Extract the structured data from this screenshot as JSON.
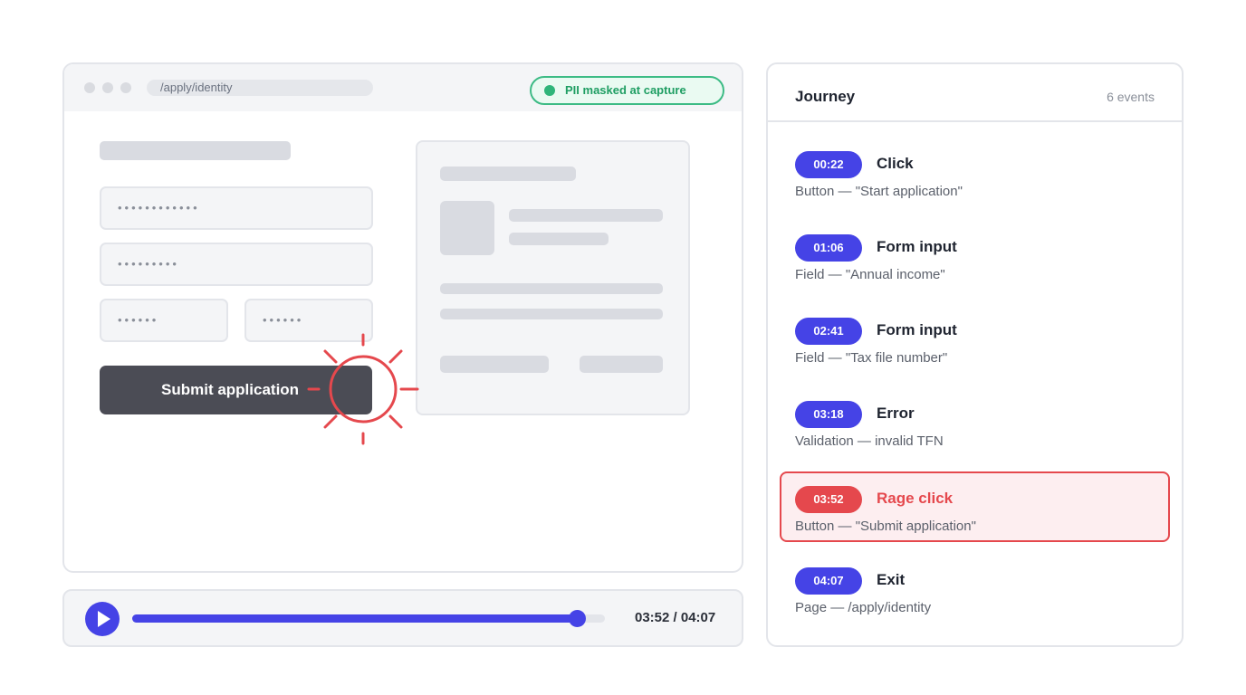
{
  "browser": {
    "url": "/apply/identity",
    "pii_badge": "PII masked at capture",
    "fields": [
      "••••••••••••",
      "•••••••••",
      "••••••",
      "••••••"
    ],
    "submit_label": "Submit application"
  },
  "player": {
    "time": "03:52 / 04:07",
    "progress": 0.94
  },
  "journey": {
    "title": "Journey",
    "count": "6 events",
    "events": [
      {
        "time": "00:22",
        "name": "Click",
        "desc": "Button — \"Start application\""
      },
      {
        "time": "01:06",
        "name": "Form input",
        "desc": "Field — \"Annual income\""
      },
      {
        "time": "02:41",
        "name": "Form input",
        "desc": "Field — \"Tax file number\""
      },
      {
        "time": "03:18",
        "name": "Error",
        "desc": "Validation — invalid TFN"
      },
      {
        "time": "03:52",
        "name": "Rage click",
        "desc": "Button — \"Submit application\""
      },
      {
        "time": "04:07",
        "name": "Exit",
        "desc": "Page — /apply/identity"
      }
    ]
  },
  "colors": {
    "accent": "#4543e6",
    "alert": "#e5484d",
    "success": "#2fb57a",
    "button_dark": "#4b4c55"
  },
  "icons": {
    "play": "play-icon",
    "rage": "rage-click-burst-icon",
    "status": "status-dot-icon"
  }
}
